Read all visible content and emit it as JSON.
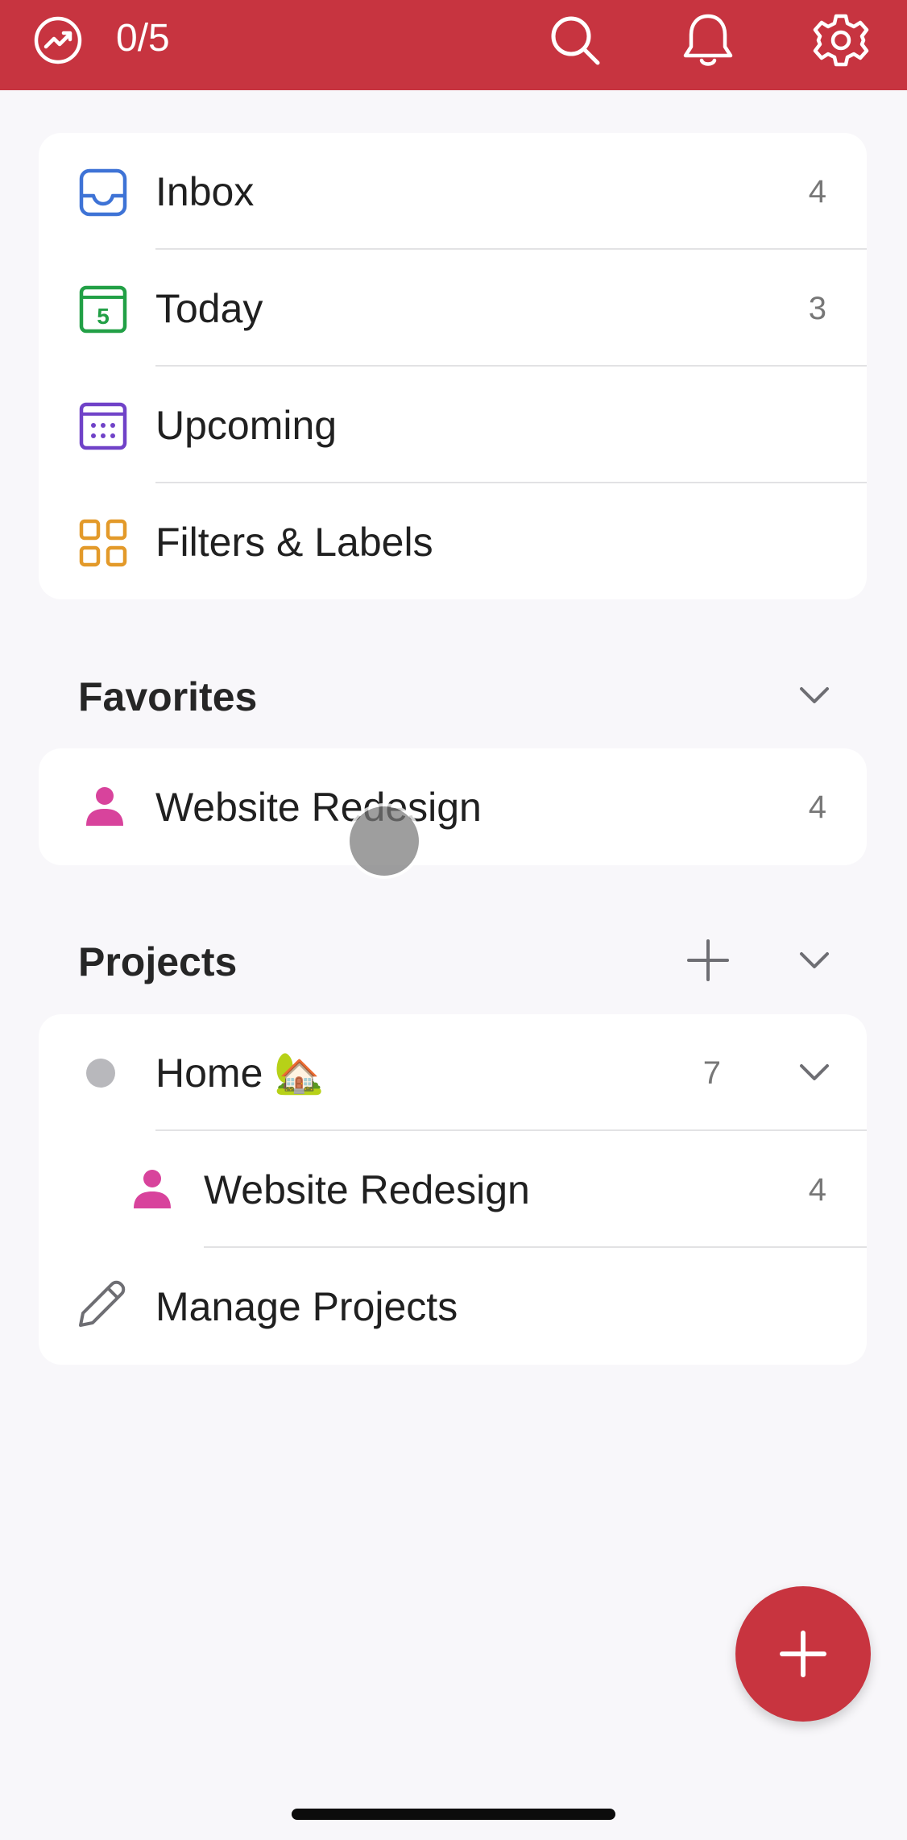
{
  "header": {
    "karma_icon": "productivity-trend-icon",
    "karma_text": "0/5",
    "search_icon": "search-icon",
    "notifications_icon": "bell-icon",
    "settings_icon": "gear-icon"
  },
  "nav": {
    "items": [
      {
        "label": "Inbox",
        "count": "4",
        "icon": "inbox-icon",
        "color": "#3e73d6"
      },
      {
        "label": "Today",
        "count": "3",
        "icon": "calendar-today-icon",
        "day": "5",
        "color": "#22a046"
      },
      {
        "label": "Upcoming",
        "count": "",
        "icon": "calendar-upcoming-icon",
        "color": "#7042c8"
      },
      {
        "label": "Filters & Labels",
        "count": "",
        "icon": "filters-grid-icon",
        "color": "#e39a2a"
      }
    ]
  },
  "favorites": {
    "title": "Favorites",
    "items": [
      {
        "label": "Website Redesign",
        "count": "4",
        "icon": "person-icon",
        "color": "#d8439c"
      }
    ]
  },
  "projects": {
    "title": "Projects",
    "items": [
      {
        "label": "Home 🏡",
        "count": "7",
        "icon": "project-dot-icon",
        "color": "#b8b8bc"
      },
      {
        "label": "Website Redesign",
        "count": "4",
        "icon": "person-icon",
        "color": "#d8439c"
      }
    ],
    "manage_label": "Manage Projects"
  },
  "colors": {
    "brand": "#c73440",
    "fab": "#c8343f"
  }
}
